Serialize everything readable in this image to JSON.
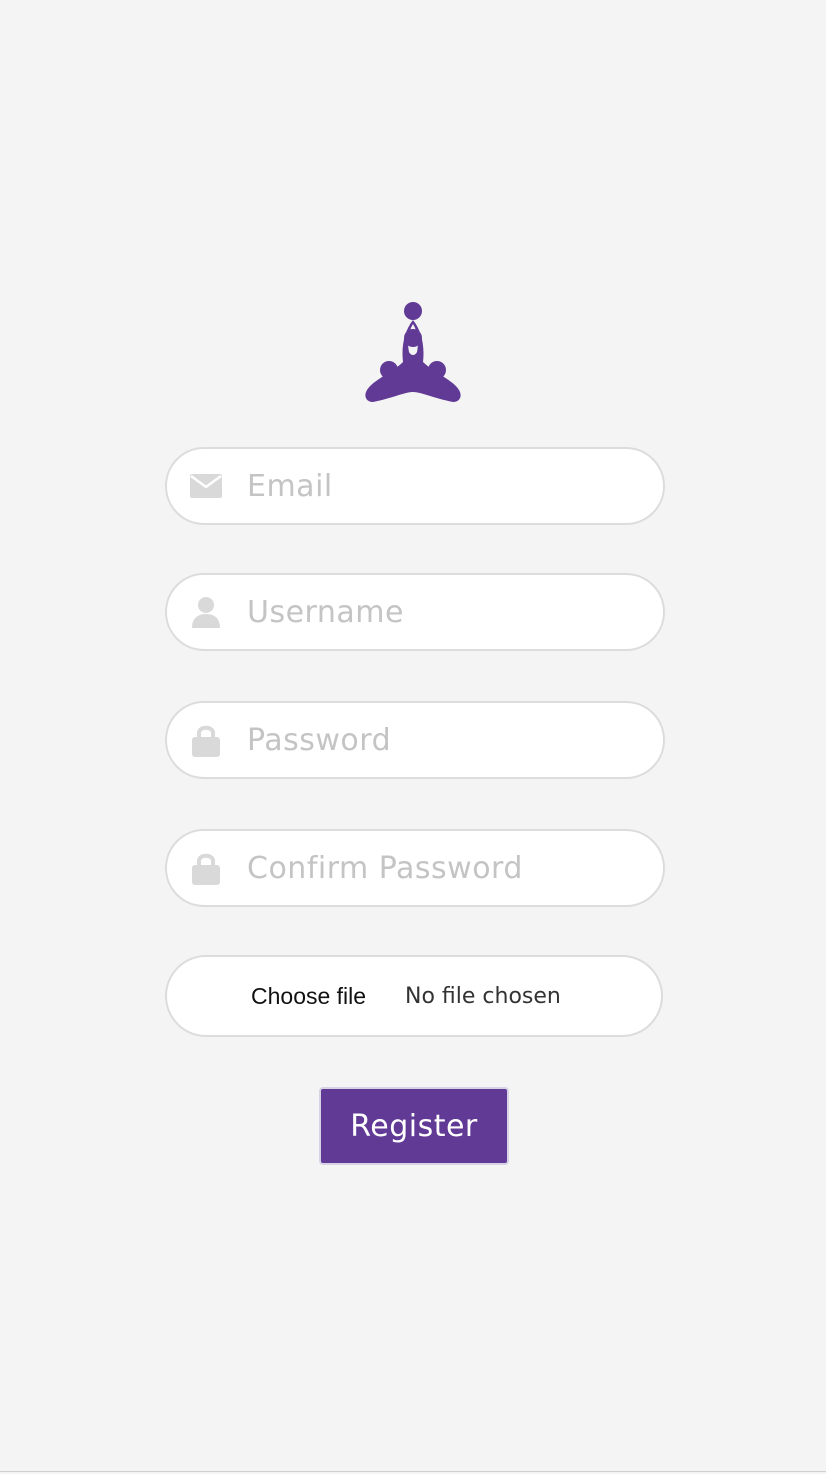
{
  "brand": {
    "logo_icon": "meditation-figure-icon",
    "color": "#613a96"
  },
  "form": {
    "email": {
      "placeholder": "Email",
      "value": "",
      "icon": "envelope-icon"
    },
    "username": {
      "placeholder": "Username",
      "value": "",
      "icon": "user-icon"
    },
    "password": {
      "placeholder": "Password",
      "value": "",
      "icon": "lock-icon"
    },
    "confirm_password": {
      "placeholder": "Confirm Password",
      "value": "",
      "icon": "lock-icon"
    },
    "file": {
      "button_label": "Choose file",
      "status": "No file chosen"
    },
    "submit_label": "Register"
  },
  "colors": {
    "background": "#f4f4f4",
    "field_border": "#dcdcdc",
    "icon": "#d9d9d9",
    "placeholder": "#c4c4c4",
    "button": "#613a96"
  }
}
